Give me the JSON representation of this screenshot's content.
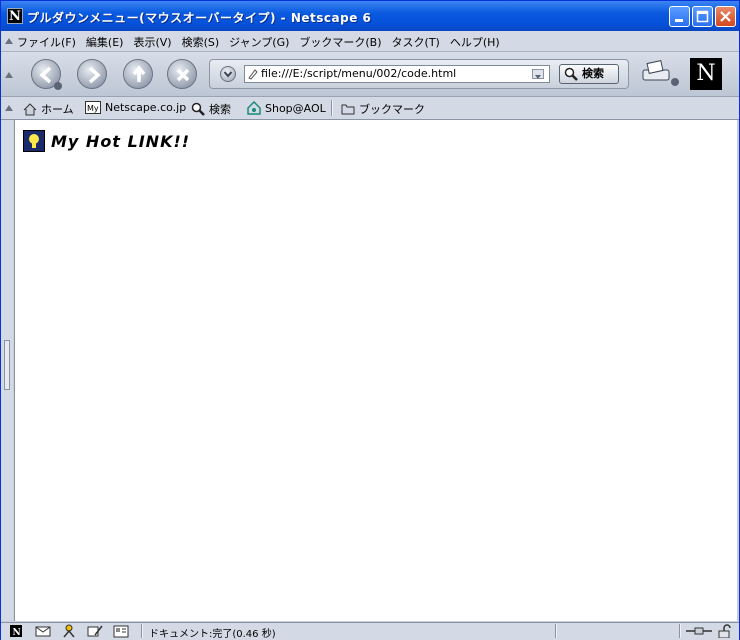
{
  "window": {
    "title": "プルダウンメニュー(マウスオーバータイプ) - Netscape 6",
    "app_icon": "N"
  },
  "menubar": {
    "items": [
      "ファイル(F)",
      "編集(E)",
      "表示(V)",
      "検索(S)",
      "ジャンプ(G)",
      "ブックマーク(B)",
      "タスク(T)",
      "ヘルプ(H)"
    ]
  },
  "navigation": {
    "url": "file:///E:/script/menu/002/code.html",
    "search_label": "検索",
    "throbber": "N"
  },
  "personal_toolbar": {
    "items": [
      {
        "label": "ホーム",
        "icon": "home-icon"
      },
      {
        "label": "Netscape.co.jp",
        "icon": "my-netscape-icon"
      },
      {
        "label": "検索",
        "icon": "search-icon"
      },
      {
        "label": "Shop@AOL",
        "icon": "shop-icon"
      },
      {
        "label": "ブックマーク",
        "icon": "folder-icon"
      }
    ]
  },
  "page": {
    "heading": "My Hot LINK!!"
  },
  "status": {
    "text": "ドキュメント:完了(0.46 秒)"
  }
}
